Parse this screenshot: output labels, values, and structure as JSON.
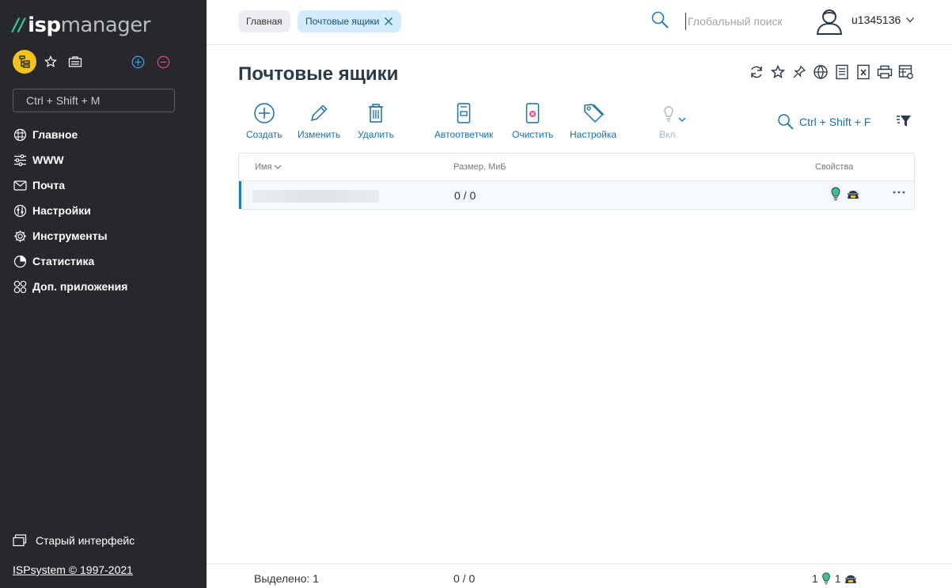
{
  "app": {
    "logo_mark": "//",
    "logo_isp": "isp",
    "logo_manager": "manager"
  },
  "sidebar": {
    "search_placeholder": "Ctrl + Shift + M",
    "items": [
      {
        "label": "Главное",
        "icon": "dashboard-icon"
      },
      {
        "label": "WWW",
        "icon": "sliders-icon"
      },
      {
        "label": "Почта",
        "icon": "mail-icon"
      },
      {
        "label": "Настройки",
        "icon": "settings-dial-icon"
      },
      {
        "label": "Инструменты",
        "icon": "gear-icon"
      },
      {
        "label": "Статистика",
        "icon": "pie-chart-icon"
      },
      {
        "label": "Доп. приложения",
        "icon": "apps-icon"
      }
    ],
    "old_interface": "Старый интерфейс",
    "copyright": "ISPsystem © 1997-2021"
  },
  "topbar": {
    "crumb_home": "Главная",
    "crumb_active": "Почтовые ящики",
    "global_search_placeholder": "Глобальный поиск",
    "username": "u1345136"
  },
  "main": {
    "title": "Почтовые ящики",
    "toolbar": {
      "create": "Создать",
      "edit": "Изменить",
      "delete": "Удалить",
      "autoresponder": "Автоответчик",
      "clear": "Очистить",
      "settings": "Настройка",
      "enable": "Вкл."
    },
    "filter_search": "Ctrl + Shift + F"
  },
  "table": {
    "columns": {
      "name": "Имя",
      "size": "Размер, МиБ",
      "properties": "Свойства"
    },
    "rows": [
      {
        "size": "0 / 0"
      }
    ]
  },
  "footer": {
    "selected": "Выделено: 1",
    "size_total": "0 / 0",
    "count_enabled": "1",
    "count_spam": "1"
  },
  "colors": {
    "accent": "#1a6fa8",
    "sidebar_bg": "#26282c",
    "logo_green": "#3ec28f",
    "avatar_yellow": "#f2c31a",
    "row_marker": "#1a7dc4"
  }
}
